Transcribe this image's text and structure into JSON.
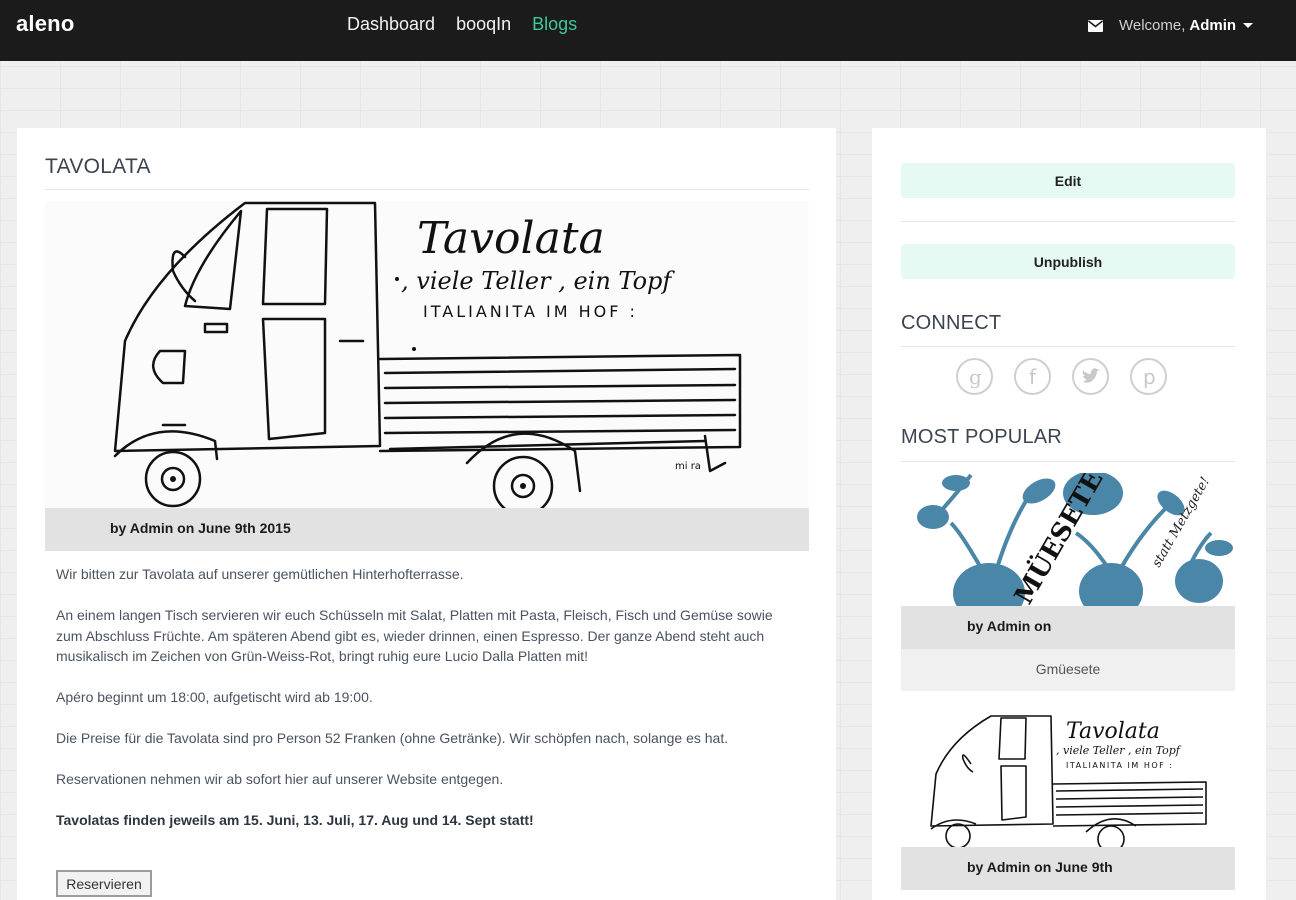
{
  "nav": {
    "brand": "aleno",
    "links": [
      {
        "label": "Dashboard",
        "active": false
      },
      {
        "label": "booqIn",
        "active": false
      },
      {
        "label": "Blogs",
        "active": true
      }
    ],
    "welcome": "Welcome,",
    "user": "Admin",
    "mail_icon": "envelope-icon",
    "active_color": "#3fc79a"
  },
  "post": {
    "title": "TAVOLATA",
    "image_caption": {
      "line1": "Tavolata",
      "line2": ", viele Teller , ein Topf",
      "line3": "ITALIANITA  IM  HOF :",
      "signature": "mi ra"
    },
    "byline": "by Admin on June 9th 2015",
    "paragraphs": [
      "Wir bitten zur Tavolata auf unserer gemütlichen Hinterhofterrasse.",
      " An einem langen Tisch servieren wir euch Schüsseln mit Salat, Platten mit Pasta, Fleisch, Fisch und Gemüse sowie zum Abschluss Früchte. Am späteren Abend gibt es, wieder drinnen, einen Espresso. Der ganze Abend steht auch musikalisch im Zeichen von Grün-Weiss-Rot, bringt ruhig eure Lucio Dalla Platten mit!",
      "Apéro beginnt um 18:00, aufgetischt wird ab 19:00.",
      "Die Preise für die Tavolata sind pro Person 52 Franken (ohne Getränke). Wir schöpfen nach, solange es hat.",
      "Reservationen nehmen wir ab sofort hier auf unserer Website entgegen."
    ],
    "bold_paragraph": "Tavolatas finden jeweils am 15. Juni,  13. Juli, 17. Aug und 14. Sept statt!",
    "reserve_label": "Reservieren"
  },
  "sidebar": {
    "edit_label": "Edit",
    "unpublish_label": "Unpublish",
    "connect_heading": "CONNECT",
    "social": [
      "google-icon",
      "facebook-icon",
      "twitter-icon",
      "pinterest-icon"
    ],
    "popular_heading": "MOST POPULAR",
    "popular": [
      {
        "image_text": "MÜESETE",
        "image_subtext": "statt Metzgete!",
        "byline": "by Admin on",
        "title": "Gmüesete"
      },
      {
        "image_text": "Tavolata",
        "image_subtext": ", viele Teller , ein Topf",
        "image_subtext2": "ITALIANITA  IM  HOF :",
        "byline": "by Admin on June 9th"
      }
    ]
  }
}
